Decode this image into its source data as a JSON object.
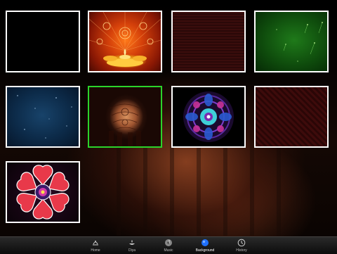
{
  "backgrounds": [
    {
      "id": "black",
      "selected": false
    },
    {
      "id": "diya-orange",
      "selected": false
    },
    {
      "id": "dark-red",
      "selected": false
    },
    {
      "id": "green-sparkle",
      "selected": false
    },
    {
      "id": "blue-stars",
      "selected": false
    },
    {
      "id": "henna-hands",
      "selected": true
    },
    {
      "id": "rangoli-mandala",
      "selected": false
    },
    {
      "id": "red-pattern",
      "selected": false
    },
    {
      "id": "rangoli-hearts",
      "selected": false
    }
  ],
  "tabbar": {
    "tabs": [
      {
        "label": "Home",
        "icon": "home-icon",
        "active": false
      },
      {
        "label": "Diya",
        "icon": "diya-icon",
        "active": false
      },
      {
        "label": "Music",
        "icon": "music-icon",
        "active": false
      },
      {
        "label": "Background",
        "icon": "background-icon",
        "active": true
      },
      {
        "label": "History",
        "icon": "clock-icon",
        "active": false
      }
    ]
  },
  "colors": {
    "selected_border": "#2bd42b",
    "tile_border": "#ffffff",
    "active_tab_icon": "#1e6fff"
  }
}
